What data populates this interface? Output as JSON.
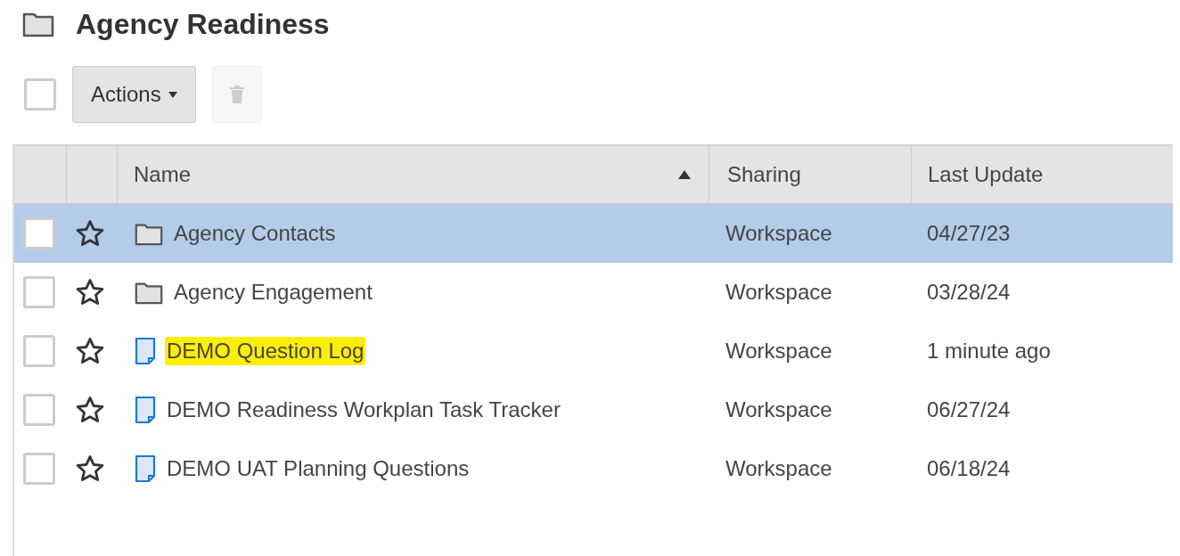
{
  "folder": {
    "title": "Agency Readiness"
  },
  "toolbar": {
    "select_all": {
      "checked": false
    },
    "actions_button": "Actions",
    "delete_button": {
      "disabled": true
    }
  },
  "table": {
    "columns": [
      {
        "label": "Name",
        "sorted": true
      },
      {
        "label": "Sharing",
        "sorted": false
      },
      {
        "label": "Last Update",
        "sorted": false
      }
    ],
    "rows": [
      {
        "kind": "folder",
        "name": "Agency Contacts",
        "sharing": "Workspace",
        "updated": "04/27/23",
        "selected": true,
        "checked": false,
        "starred": false,
        "highlighted": false
      },
      {
        "kind": "folder",
        "name": "Agency Engagement",
        "sharing": "Workspace",
        "updated": "03/28/24",
        "selected": false,
        "checked": false,
        "starred": false,
        "highlighted": false
      },
      {
        "kind": "sheet",
        "name": "DEMO Question Log",
        "sharing": "Workspace",
        "updated": "1 minute ago",
        "selected": false,
        "checked": false,
        "starred": false,
        "highlighted": true
      },
      {
        "kind": "sheet",
        "name": "DEMO Readiness Workplan Task Tracker",
        "sharing": "Workspace",
        "updated": "06/27/24",
        "selected": false,
        "checked": false,
        "starred": false,
        "highlighted": false
      },
      {
        "kind": "sheet",
        "name": "DEMO UAT Planning Questions",
        "sharing": "Workspace",
        "updated": "06/18/24",
        "selected": false,
        "checked": false,
        "starred": false,
        "highlighted": false
      }
    ]
  }
}
